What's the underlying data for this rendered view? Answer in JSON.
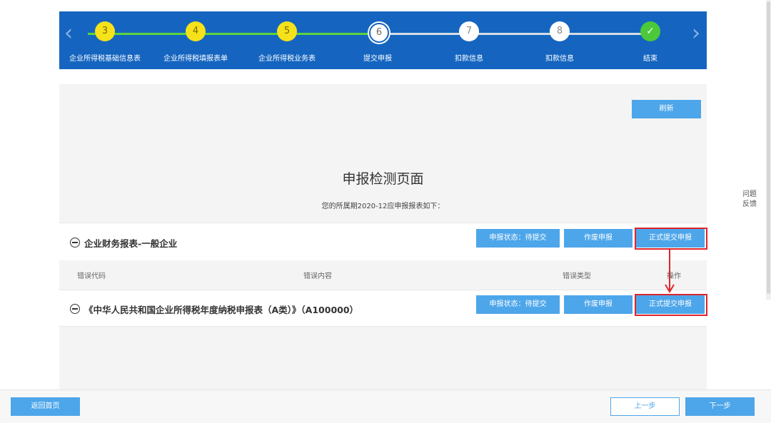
{
  "steps": [
    {
      "num": "3",
      "label": "企业所得税基础信息表",
      "state": "done"
    },
    {
      "num": "4",
      "label": "企业所得税填报表单",
      "state": "done"
    },
    {
      "num": "5",
      "label": "企业所得税业务表",
      "state": "done"
    },
    {
      "num": "6",
      "label": "提交申报",
      "state": "current"
    },
    {
      "num": "7",
      "label": "扣款信息",
      "state": "todo"
    },
    {
      "num": "8",
      "label": "扣款信息",
      "state": "todo"
    },
    {
      "num": "✓",
      "label": "结束",
      "state": "finish"
    }
  ],
  "nav": {
    "prev_icon": "chevron-left-icon",
    "next_icon": "chevron-right-icon"
  },
  "panel": {
    "refresh_label": "刷新",
    "title": "申报检测页面",
    "subtitle": "您的所属期2020-12应申报报表如下："
  },
  "sections": [
    {
      "title": "企业财务报表-一般企业",
      "status_label": "申报状态：待提交",
      "void_label": "作废申报",
      "submit_label": "正式提交申报"
    },
    {
      "title": "《中华人民共和国企业所得税年度纳税申报表（A类）》（A100000）",
      "status_label": "申报状态：待提交",
      "void_label": "作废申报",
      "submit_label": "正式提交申报"
    }
  ],
  "error_table": {
    "headers": [
      "错误代码",
      "错误内容",
      "错误类型",
      "操作"
    ]
  },
  "feedback": {
    "line1": "问题",
    "line2": "反馈"
  },
  "bottom": {
    "home_label": "返回首页",
    "prev_label": "上一步",
    "next_label": "下一步"
  },
  "colors": {
    "stepbar_bg": "#1565c0",
    "accent_button": "#4da6ea",
    "done_step": "#f5e21a",
    "finish_step": "#4cc93a",
    "highlight": "#e0242a"
  }
}
